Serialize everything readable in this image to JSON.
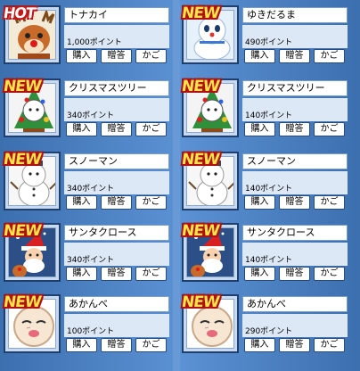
{
  "items": [
    {
      "badge": "HOT",
      "name": "トナカイ",
      "price": "1,000ポイント",
      "icon": "reindeer-icon"
    },
    {
      "badge": "NEW",
      "name": "ゆきだるま",
      "price": "490ポイント",
      "icon": "snowman-plush-icon"
    },
    {
      "badge": "NEW",
      "name": "クリスマスツリー",
      "price": "340ポイント",
      "icon": "christmas-tree-costume-icon"
    },
    {
      "badge": "NEW",
      "name": "クリスマスツリー",
      "price": "140ポイント",
      "icon": "christmas-tree-costume-icon"
    },
    {
      "badge": "NEW",
      "name": "スノーマン",
      "price": "340ポイント",
      "icon": "snowman-costume-icon"
    },
    {
      "badge": "NEW",
      "name": "スノーマン",
      "price": "140ポイント",
      "icon": "snowman-costume-icon"
    },
    {
      "badge": "NEW",
      "name": "サンタクロース",
      "price": "340ポイント",
      "icon": "santa-costume-icon"
    },
    {
      "badge": "NEW",
      "name": "サンタクロース",
      "price": "140ポイント",
      "icon": "santa-costume-icon"
    },
    {
      "badge": "NEW",
      "name": "あかんべ",
      "price": "100ポイント",
      "icon": "akanbe-face-icon"
    },
    {
      "badge": "NEW",
      "name": "あかんべ",
      "price": "290ポイント",
      "icon": "akanbe-face-icon"
    }
  ],
  "buttons": {
    "buy": "購入",
    "gift": "贈答",
    "cart": "かご"
  }
}
